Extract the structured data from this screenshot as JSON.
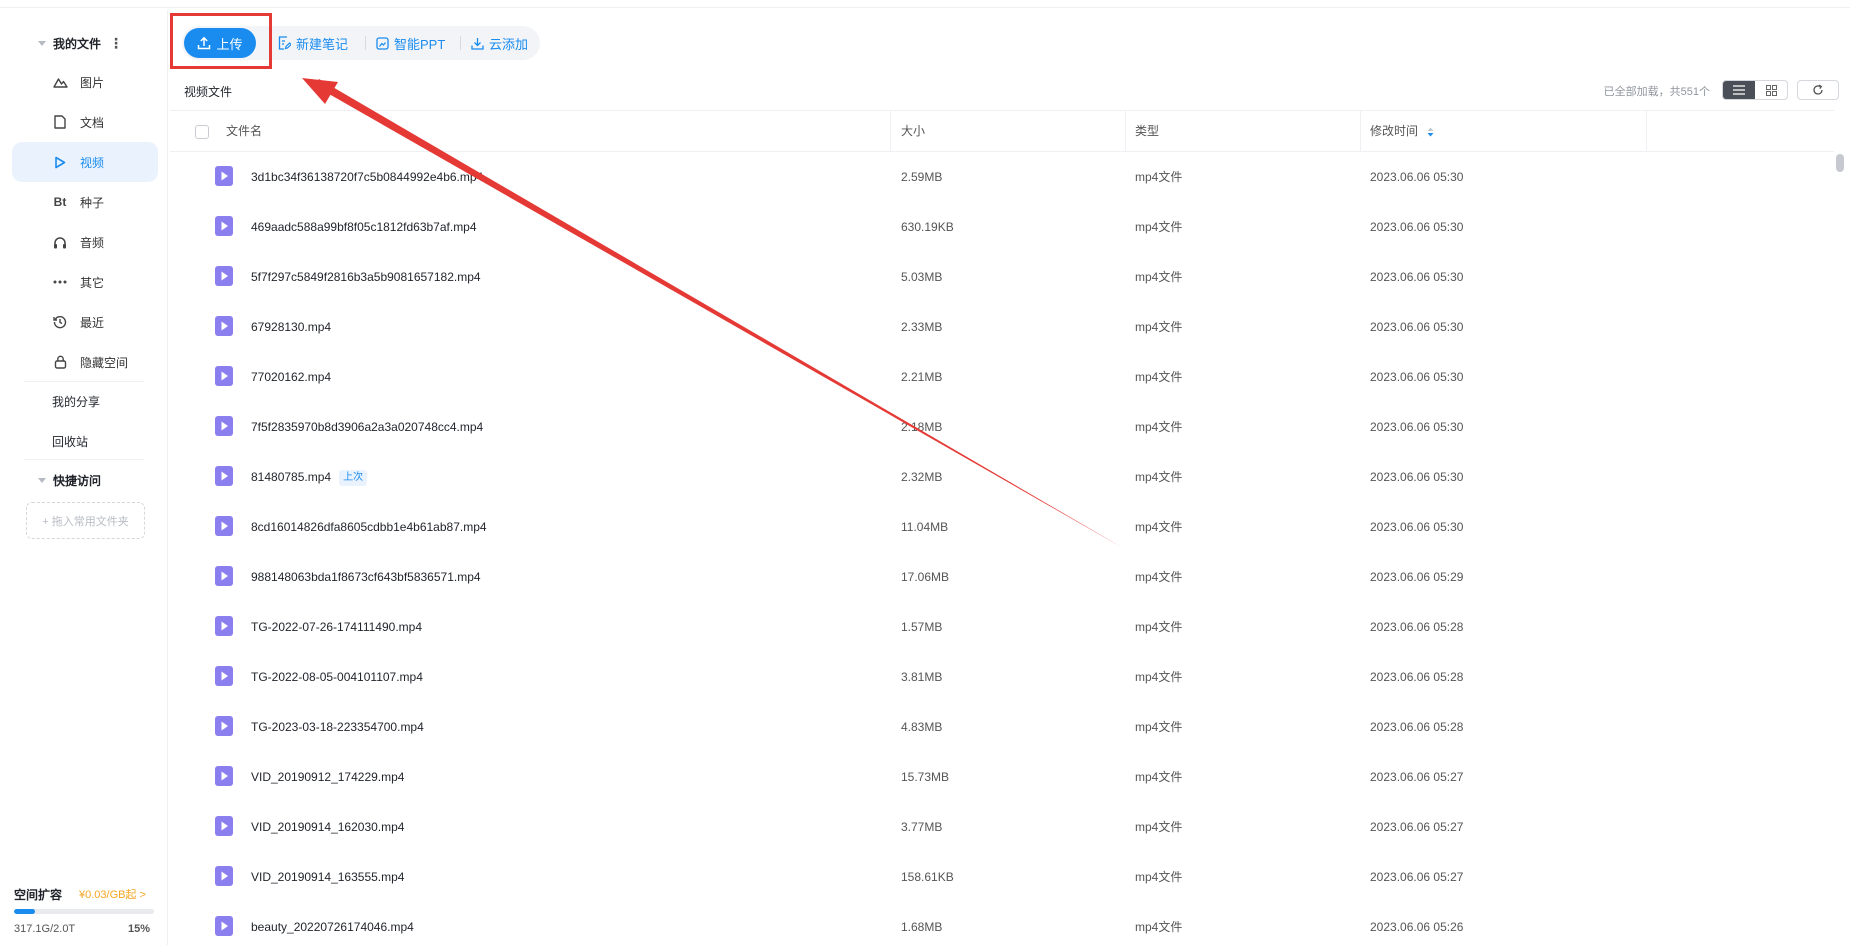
{
  "sidebar": {
    "my_files": {
      "label": "我的文件"
    },
    "items": [
      {
        "label": "图片",
        "icon": "image-icon"
      },
      {
        "label": "文档",
        "icon": "document-icon"
      },
      {
        "label": "视频",
        "icon": "play-icon",
        "active": true
      },
      {
        "label": "种子",
        "icon": "bt-icon",
        "icon_text": "Bt"
      },
      {
        "label": "音频",
        "icon": "headphones-icon"
      },
      {
        "label": "其它",
        "icon": "more-icon"
      },
      {
        "label": "最近",
        "icon": "recent-icon"
      },
      {
        "label": "隐藏空间",
        "icon": "lock-icon"
      }
    ],
    "my_share": "我的分享",
    "recycle": "回收站",
    "quick_access": {
      "label": "快捷访问",
      "pin_hint": "+ 拖入常用文件夹"
    },
    "quota": {
      "title": "空间扩容",
      "price": "¥0.03/GB起 >",
      "used": "317.1G/2.0T",
      "percent_label": "15%",
      "percent": 15
    }
  },
  "toolbar": {
    "upload": "上传",
    "new_note": "新建笔记",
    "smart_ppt": "智能PPT",
    "cloud_add": "云添加"
  },
  "breadcrumb": "视频文件",
  "loaded_status": "已全部加载，共551个",
  "table": {
    "headers": {
      "name": "文件名",
      "size": "大小",
      "type": "类型",
      "modified": "修改时间"
    },
    "rows": [
      {
        "name": "3d1bc34f36138720f7c5b0844992e4b6.mp4",
        "size": "2.59MB",
        "type": "mp4文件",
        "modified": "2023.06.06 05:30"
      },
      {
        "name": "469aadc588a99bf8f05c1812fd63b7af.mp4",
        "size": "630.19KB",
        "type": "mp4文件",
        "modified": "2023.06.06 05:30"
      },
      {
        "name": "5f7f297c5849f2816b3a5b9081657182.mp4",
        "size": "5.03MB",
        "type": "mp4文件",
        "modified": "2023.06.06 05:30"
      },
      {
        "name": "67928130.mp4",
        "size": "2.33MB",
        "type": "mp4文件",
        "modified": "2023.06.06 05:30"
      },
      {
        "name": "77020162.mp4",
        "size": "2.21MB",
        "type": "mp4文件",
        "modified": "2023.06.06 05:30"
      },
      {
        "name": "7f5f2835970b8d3906a2a3a020748cc4.mp4",
        "size": "2.18MB",
        "type": "mp4文件",
        "modified": "2023.06.06 05:30"
      },
      {
        "name": "81480785.mp4",
        "tag": "上次",
        "size": "2.32MB",
        "type": "mp4文件",
        "modified": "2023.06.06 05:30"
      },
      {
        "name": "8cd16014826dfa8605cdbb1e4b61ab87.mp4",
        "size": "11.04MB",
        "type": "mp4文件",
        "modified": "2023.06.06 05:30"
      },
      {
        "name": "988148063bda1f8673cf643bf5836571.mp4",
        "size": "17.06MB",
        "type": "mp4文件",
        "modified": "2023.06.06 05:29"
      },
      {
        "name": "TG-2022-07-26-174111490.mp4",
        "size": "1.57MB",
        "type": "mp4文件",
        "modified": "2023.06.06 05:28"
      },
      {
        "name": "TG-2022-08-05-004101107.mp4",
        "size": "3.81MB",
        "type": "mp4文件",
        "modified": "2023.06.06 05:28"
      },
      {
        "name": "TG-2023-03-18-223354700.mp4",
        "size": "4.83MB",
        "type": "mp4文件",
        "modified": "2023.06.06 05:28"
      },
      {
        "name": "VID_20190912_174229.mp4",
        "size": "15.73MB",
        "type": "mp4文件",
        "modified": "2023.06.06 05:27"
      },
      {
        "name": "VID_20190914_162030.mp4",
        "size": "3.77MB",
        "type": "mp4文件",
        "modified": "2023.06.06 05:27"
      },
      {
        "name": "VID_20190914_163555.mp4",
        "size": "158.61KB",
        "type": "mp4文件",
        "modified": "2023.06.06 05:27"
      },
      {
        "name": "beauty_20220726174046.mp4",
        "size": "1.68MB",
        "type": "mp4文件",
        "modified": "2023.06.06 05:26"
      }
    ]
  },
  "colors": {
    "accent": "#1a8cf0",
    "annotation": "#e53935",
    "file_icon": "#8b7ff0",
    "price": "#f5a623"
  }
}
